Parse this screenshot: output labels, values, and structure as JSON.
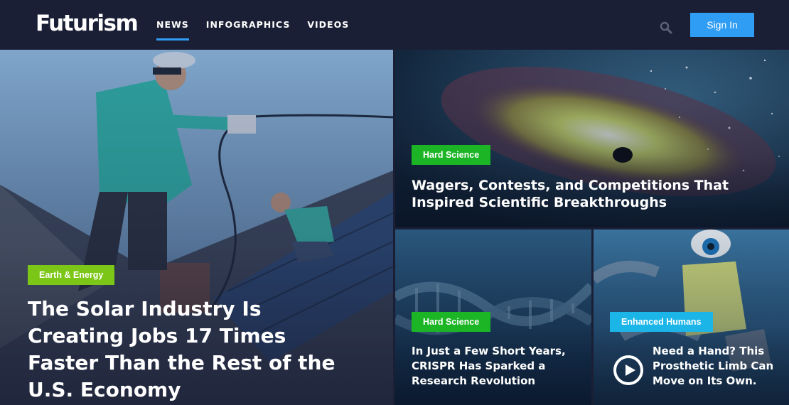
{
  "header": {
    "logo": "Futurism",
    "nav": [
      {
        "label": "NEWS",
        "active": true
      },
      {
        "label": "INFOGRAPHICS",
        "active": false
      },
      {
        "label": "VIDEOS",
        "active": false
      }
    ],
    "search_icon": "search-icon",
    "signin_label": "Sign In"
  },
  "colors": {
    "header_bg": "#1b1f35",
    "accent": "#2f9df4",
    "earth_energy": "#7cc618",
    "hard_science": "#1bb525",
    "enhanced_humans": "#1cb5e8"
  },
  "articles": [
    {
      "category": "Earth & Energy",
      "title": "The Solar Industry Is Creating Jobs 17 Times Faster Than the Rest of the U.S. Economy"
    },
    {
      "category": "Hard Science",
      "title": "Wagers, Contests, and Competitions That Inspired Scientific Breakthroughs"
    },
    {
      "category": "Hard Science",
      "title": "In Just a Few Short Years, CRISPR Has Sparked a Research Revolution"
    },
    {
      "category": "Enhanced Humans",
      "title": "Need a Hand? This Prosthetic Limb Can Move on Its Own.",
      "icon": "play-icon"
    }
  ]
}
